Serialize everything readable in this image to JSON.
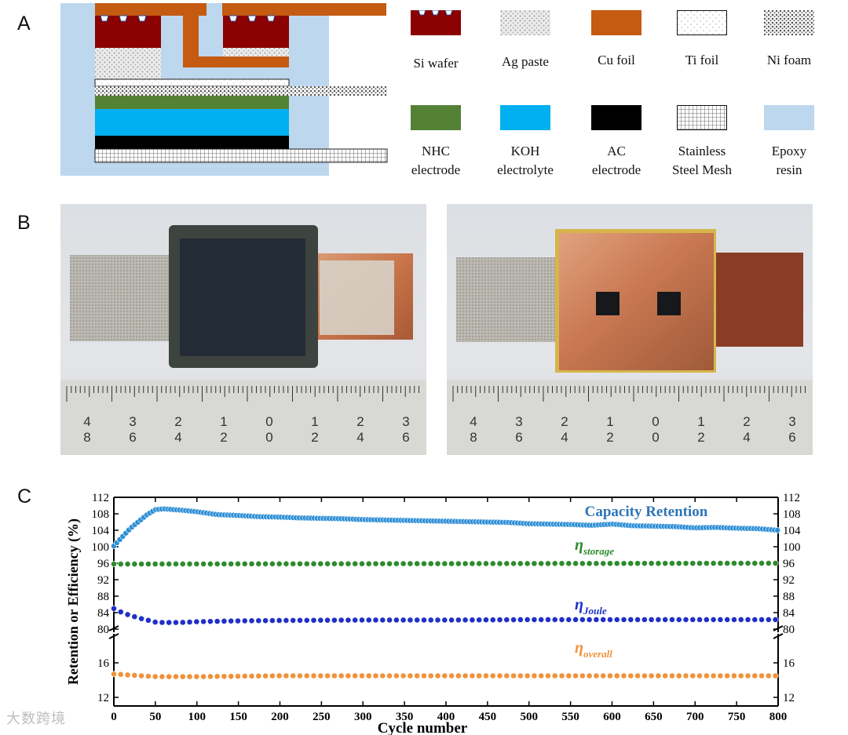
{
  "figure": {
    "panel_labels": [
      "A",
      "B",
      "C"
    ],
    "watermark": "大数跨境"
  },
  "panel_a": {
    "legend": [
      {
        "label_lines": [
          "Si wafer"
        ],
        "swatch": "si-wafer",
        "color": "#8b0000"
      },
      {
        "label_lines": [
          "Ag paste"
        ],
        "swatch": "ag-paste",
        "color": "#c8c8c8"
      },
      {
        "label_lines": [
          "Cu foil"
        ],
        "swatch": "cu-foil",
        "color": "#c55a11"
      },
      {
        "label_lines": [
          "Ti foil"
        ],
        "swatch": "ti-foil",
        "color": "#ffffff"
      },
      {
        "label_lines": [
          "Ni foam"
        ],
        "swatch": "ni-foam",
        "color": "#777777"
      },
      {
        "label_lines": [
          "NHC",
          "electrode"
        ],
        "swatch": "nhc-electrode",
        "color": "#548235"
      },
      {
        "label_lines": [
          "KOH",
          "electrolyte"
        ],
        "swatch": "koh-electrolyte",
        "color": "#00b0f0"
      },
      {
        "label_lines": [
          "AC",
          "electrode"
        ],
        "swatch": "ac-electrode",
        "color": "#000000"
      },
      {
        "label_lines": [
          "Stainless",
          "Steel Mesh"
        ],
        "swatch": "steel-mesh",
        "color": "#ffffff"
      },
      {
        "label_lines": [
          "Epoxy",
          "resin"
        ],
        "swatch": "epoxy-resin",
        "color": "#bdd7ee"
      }
    ]
  },
  "panel_b": {
    "ruler_labels_left": [
      [
        "4",
        "8"
      ],
      [
        "3",
        "6"
      ],
      [
        "2",
        "4"
      ],
      [
        "1",
        "2"
      ],
      [
        "0",
        "0"
      ],
      [
        "1",
        "2"
      ],
      [
        "2",
        "4"
      ],
      [
        "3",
        "6"
      ]
    ],
    "ruler_labels_right": [
      [
        "4",
        "8"
      ],
      [
        "3",
        "6"
      ],
      [
        "2",
        "4"
      ],
      [
        "1",
        "2"
      ],
      [
        "0",
        "0"
      ],
      [
        "1",
        "2"
      ],
      [
        "2",
        "4"
      ],
      [
        "3",
        "6"
      ]
    ]
  },
  "chart_data": {
    "type": "scatter",
    "xlabel": "Cycle number",
    "ylabel": "Retention  or Efficiency (%)",
    "xlim": [
      0,
      800
    ],
    "x_ticks": [
      0,
      50,
      100,
      150,
      200,
      250,
      300,
      350,
      400,
      450,
      500,
      550,
      600,
      650,
      700,
      750,
      800
    ],
    "y_upper_ticks": [
      80,
      84,
      88,
      92,
      96,
      100,
      104,
      108,
      112
    ],
    "y_lower_ticks": [
      12,
      16
    ],
    "ylim_upper": [
      80,
      112
    ],
    "ylim_lower": [
      11,
      19
    ],
    "axis_break": true,
    "series": [
      {
        "name": "Capacity Retention",
        "color": "#2e8fd6",
        "label_color": "#2e75b6",
        "x": [
          0,
          20,
          40,
          50,
          60,
          80,
          100,
          125,
          150,
          175,
          200,
          225,
          250,
          275,
          300,
          325,
          350,
          375,
          400,
          425,
          450,
          475,
          500,
          525,
          550,
          575,
          600,
          625,
          650,
          675,
          700,
          725,
          750,
          775,
          800
        ],
        "y": [
          100.2,
          104.5,
          107.8,
          109.0,
          109.2,
          108.9,
          108.5,
          107.8,
          107.6,
          107.3,
          107.2,
          107.0,
          106.9,
          106.8,
          106.6,
          106.5,
          106.4,
          106.3,
          106.2,
          106.1,
          106.0,
          105.9,
          105.6,
          105.5,
          105.4,
          105.2,
          105.5,
          105.1,
          105.0,
          104.9,
          104.6,
          104.7,
          104.5,
          104.4,
          104.0
        ]
      },
      {
        "name": "η storage",
        "label_main": "η",
        "label_sub": "storage",
        "color": "#2e8b2e",
        "x": [
          0,
          800
        ],
        "y": [
          95.8,
          96.0
        ]
      },
      {
        "name": "η Joule",
        "label_main": "η",
        "label_sub": "Joule",
        "color": "#1f2fc8",
        "x": [
          0,
          10,
          20,
          30,
          40,
          50,
          60,
          80,
          100,
          150,
          200,
          300,
          400,
          500,
          600,
          700,
          800
        ],
        "y": [
          85.0,
          84.0,
          83.3,
          82.7,
          82.2,
          81.7,
          81.6,
          81.6,
          81.8,
          82.0,
          82.1,
          82.2,
          82.2,
          82.3,
          82.3,
          82.3,
          82.3
        ]
      },
      {
        "name": "η overall",
        "label_main": "η",
        "label_sub": "overall",
        "color": "#f0923a",
        "x": [
          0,
          50,
          100,
          200,
          400,
          600,
          800
        ],
        "y": [
          14.7,
          14.4,
          14.4,
          14.5,
          14.5,
          14.5,
          14.5
        ]
      }
    ]
  }
}
